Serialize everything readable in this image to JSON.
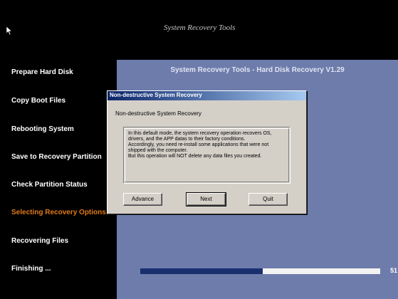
{
  "header": {
    "title": "System Recovery Tools"
  },
  "sidebar": {
    "items": [
      {
        "label": "Prepare Hard Disk"
      },
      {
        "label": "Copy Boot Files"
      },
      {
        "label": "Rebooting System"
      },
      {
        "label": "Save to Recovery Partition"
      },
      {
        "label": "Check Partition Status"
      },
      {
        "label": "Selecting Recovery Options"
      },
      {
        "label": "Recovering Files"
      },
      {
        "label": "Finishing ..."
      }
    ],
    "active_index": 5
  },
  "main": {
    "title": "System Recovery Tools - Hard Disk Recovery V1.29",
    "progress": {
      "percent_text": "51",
      "fraction": 0.51
    }
  },
  "dialog": {
    "title": "Non-destructive System Recovery",
    "subtitle": "Non-destructive System Recovery",
    "message_lines": [
      "In this default mode, the system recovery operation recovers OS,",
      "drivers, and the APP datas to their factory conditions.",
      "Accordingly, you need re-install some applications that were not",
      "shipped with the computer.",
      "But this operation will NOT delete any data files you created."
    ],
    "buttons": {
      "advance": "Advance",
      "next": "Next",
      "quit": "Quit"
    }
  },
  "colors": {
    "accent_active_step": "#e07a18",
    "main_bg": "#6d7cab",
    "progress_fill": "#1a2f6e"
  }
}
